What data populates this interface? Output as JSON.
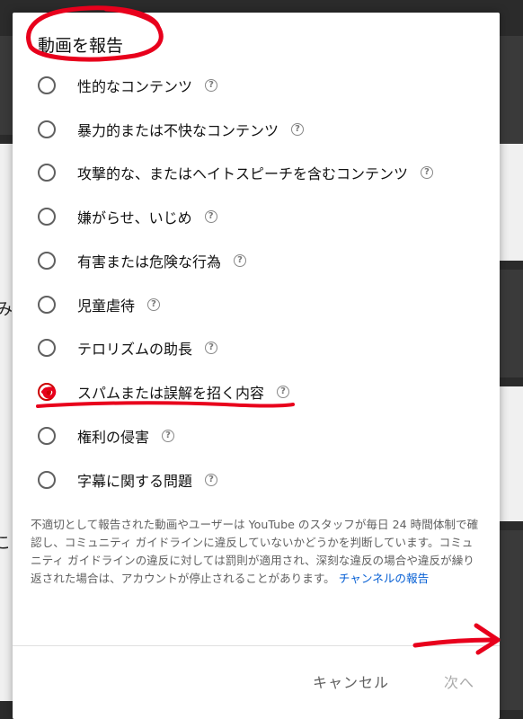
{
  "dialog": {
    "title": "動画を報告",
    "options": [
      {
        "label": "性的なコンテンツ",
        "selected": false
      },
      {
        "label": "暴力的または不快なコンテンツ",
        "selected": false
      },
      {
        "label": "攻撃的な、またはヘイトスピーチを含むコンテンツ",
        "selected": false
      },
      {
        "label": "嫌がらせ、いじめ",
        "selected": false
      },
      {
        "label": "有害または危険な行為",
        "selected": false
      },
      {
        "label": "児童虐待",
        "selected": false
      },
      {
        "label": "テロリズムの助長",
        "selected": false
      },
      {
        "label": "スパムまたは誤解を招く内容",
        "selected": true
      },
      {
        "label": "権利の侵害",
        "selected": false
      },
      {
        "label": "字幕に関する問題",
        "selected": false
      }
    ],
    "help_icon": "?",
    "notice_text": "不適切として報告された動画やユーザーは YouTube のスタッフが毎日 24 時間体制で確認し、コミュニティ ガイドラインに違反していないかどうかを判断しています。コミュニティ ガイドラインの違反に対しては罰則が適用され、深刻な違反の場合や違反が繰り返された場合は、アカウントが停止されることがあります。",
    "notice_link": "チャンネルの報告",
    "cancel_label": "キャンセル",
    "next_label": "次へ"
  },
  "background": {
    "left_char_1": "み",
    "left_char_2": "こ"
  },
  "colors": {
    "accent_red": "#cc0000",
    "link_blue": "#065fd4",
    "annotation_red": "#e8001c"
  },
  "icons": {
    "help": "question-circle-icon",
    "annotation_arrow": "arrow-right-icon"
  }
}
